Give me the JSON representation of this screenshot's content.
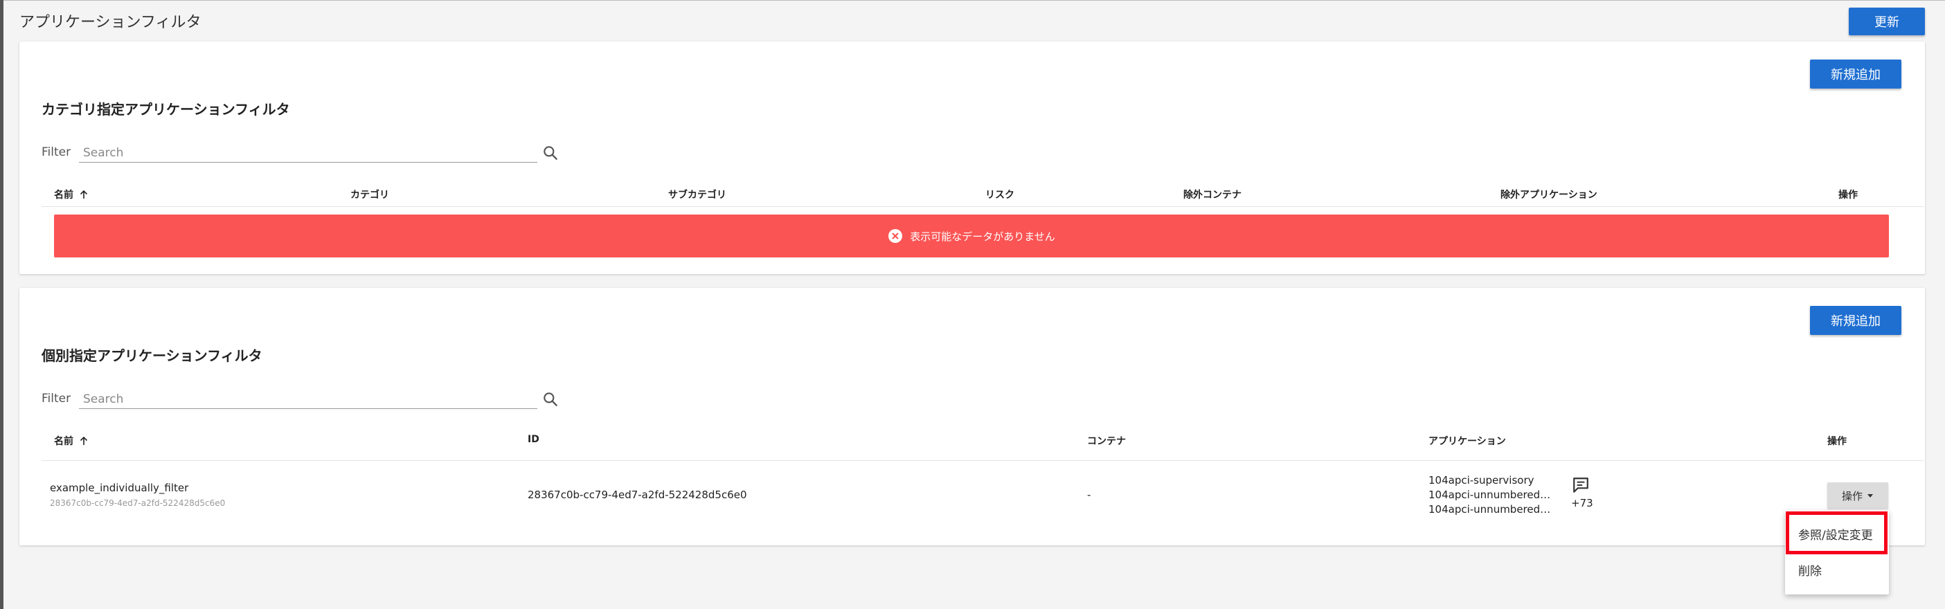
{
  "page": {
    "title": "アプリケーションフィルタ",
    "refresh_label": "更新"
  },
  "category_section": {
    "title": "カテゴリ指定アプリケーションフィルタ",
    "add_label": "新規追加",
    "filter_label": "Filter",
    "search_placeholder": "Search",
    "columns": [
      "名前",
      "カテゴリ",
      "サブカテゴリ",
      "リスク",
      "除外コンテナ",
      "除外アプリケーション",
      "操作"
    ],
    "empty_message": "表示可能なデータがありません"
  },
  "individual_section": {
    "title": "個別指定アプリケーションフィルタ",
    "add_label": "新規追加",
    "filter_label": "Filter",
    "search_placeholder": "Search",
    "columns": [
      "名前",
      "ID",
      "コンテナ",
      "アプリケーション",
      "操作"
    ],
    "rows": [
      {
        "name": "example_individually_filter",
        "name_sub": "28367c0b-cc79-4ed7-a2fd-522428d5c6e0",
        "id": "28367c0b-cc79-4ed7-a2fd-522428d5c6e0",
        "container": "-",
        "applications": [
          "104apci-supervisory",
          "104apci-unnumbered…",
          "104apci-unnumbered…"
        ],
        "more_count": "+73",
        "ops_label": "操作"
      }
    ]
  },
  "dropdown": {
    "items": [
      "参照/設定変更",
      "削除"
    ]
  },
  "colors": {
    "primary": "#1f6fd1",
    "error_banner": "#fb5454",
    "highlight": "#f5001a"
  }
}
